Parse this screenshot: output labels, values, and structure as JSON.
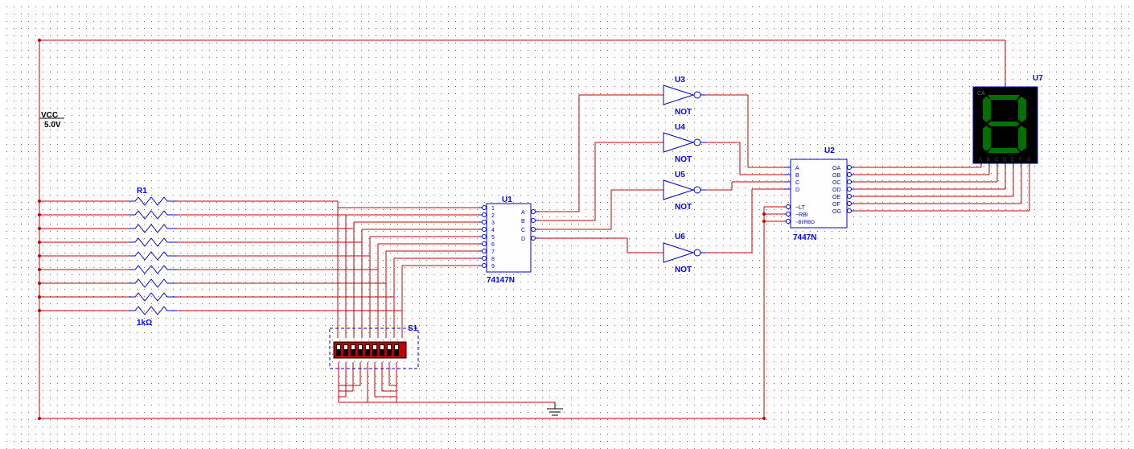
{
  "power": {
    "vcc_label": "VCC",
    "voltage": "5.0V"
  },
  "resistor": {
    "ref": "R1",
    "value": "1kΩ"
  },
  "switch": {
    "ref": "S1"
  },
  "encoder": {
    "ref": "U1",
    "part": "74147N",
    "inputs": [
      "1",
      "2",
      "3",
      "4",
      "5",
      "6",
      "7",
      "8",
      "9"
    ],
    "outputs": [
      "A",
      "B",
      "C",
      "D"
    ]
  },
  "inverters": {
    "u3": {
      "ref": "U3",
      "label": "NOT"
    },
    "u4": {
      "ref": "U4",
      "label": "NOT"
    },
    "u5": {
      "ref": "U5",
      "label": "NOT"
    },
    "u6": {
      "ref": "U6",
      "label": "NOT"
    }
  },
  "decoder": {
    "ref": "U2",
    "part": "7447N",
    "inputs": [
      "A",
      "B",
      "C",
      "D",
      "~LT",
      "~RBI",
      "~BI/RBO"
    ],
    "outputs": [
      "OA",
      "OB",
      "OC",
      "OD",
      "OE",
      "OF",
      "OG"
    ]
  },
  "display": {
    "ref": "U7",
    "type": "CA",
    "segments": [
      "A",
      "B",
      "C",
      "D",
      "E",
      "F",
      "G"
    ],
    "digit": "8"
  }
}
